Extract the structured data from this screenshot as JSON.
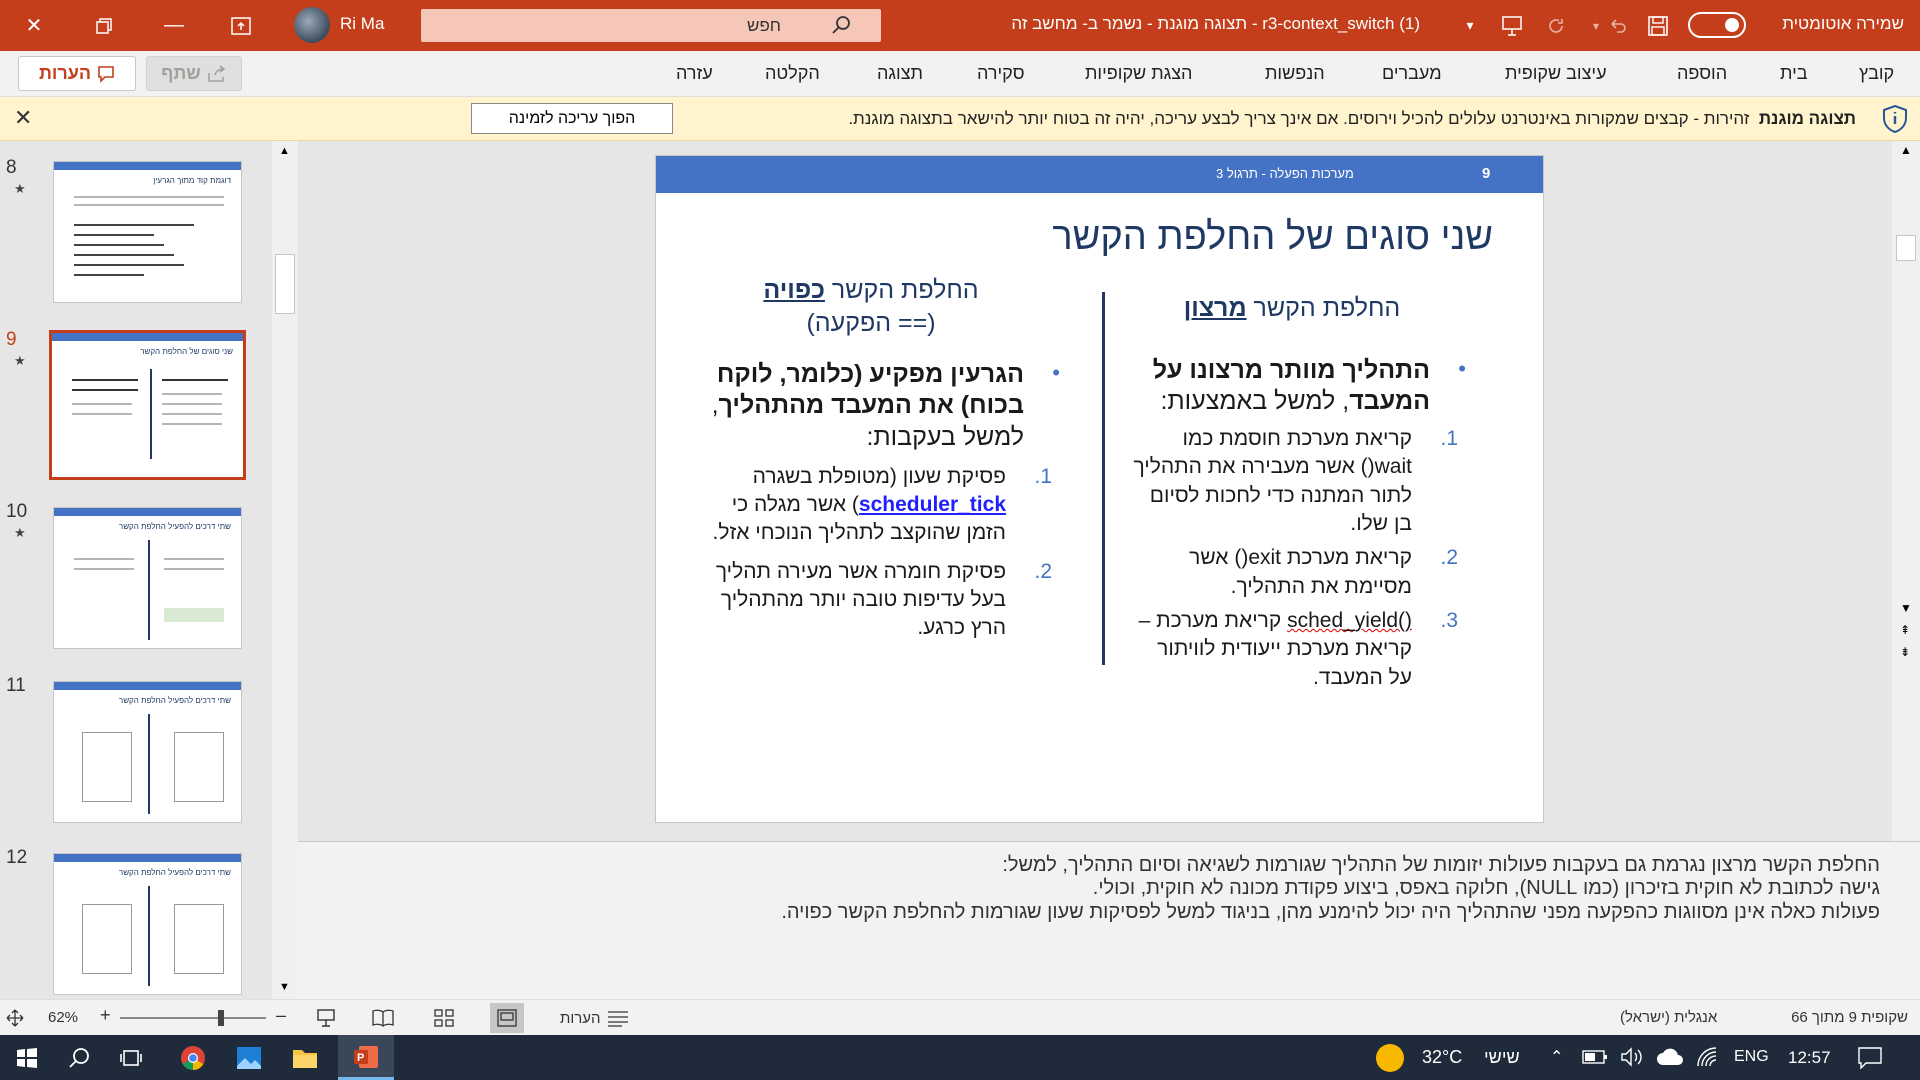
{
  "window": {
    "doc_title": "r3-context_switch (1)  -  תצוגה מוגנת  -  נשמר ב- מחשב זה",
    "autosave_label": "שמירה אוטומטית",
    "user_name": "Ri Ma",
    "search_placeholder": "חפש"
  },
  "menu": {
    "items": [
      "קובץ",
      "בית",
      "הוספה",
      "עיצוב שקופית",
      "מעברים",
      "הנפשות",
      "הצגת שקופיות",
      "סקירה",
      "תצוגה",
      "הקלטה",
      "עזרה"
    ],
    "comments_label": "הערות",
    "share_label": "שתף"
  },
  "protected_bar": {
    "title": "תצוגה מוגנת",
    "message": "זהירות - קבצים שמקורות באינטרנט עלולים להכיל וירוסים. אם אינך צריך לבצע עריכה, יהיה זה בטוח יותר להישאר בתצוגה מוגנת.",
    "enable_button": "הפוך עריכה לזמינה"
  },
  "thumbnails": [
    {
      "num": "8",
      "title": "דוגמת קוד מתוך הגרעין"
    },
    {
      "num": "9",
      "title": "שני סוגים של החלפת הקשר"
    },
    {
      "num": "10",
      "title": "שתי דרכים להפעיל החלפת הקשר"
    },
    {
      "num": "11",
      "title": "שתי דרכים להפעיל החלפת הקשר"
    },
    {
      "num": "12",
      "title": "שתי דרכים להפעיל החלפת הקשר"
    }
  ],
  "slide": {
    "number": "9",
    "header_text": "מערכות הפעלה - תרגול 3",
    "title": "שני סוגים של החלפת הקשר",
    "right_col": {
      "head_prefix": "החלפת הקשר ",
      "head_em": "מרצון",
      "bullet_bold": "התהליך מוותר מרצונו על המעבד",
      "bullet_rest": ", למשל באמצעות:",
      "items": [
        {
          "n": "1.",
          "text": "קריאת מערכת חוסמת כמו wait() אשר מעבירה את התהליך לתור המתנה כדי לחכות לסיום בן שלו."
        },
        {
          "n": "2.",
          "text": "קריאת מערכת exit() אשר מסיימת את התהליך."
        },
        {
          "n": "3.",
          "text_a": "sched_yield()",
          "text_b": " קריאת מערכת – קריאת מערכת ייעודית לוויתור על המעבד."
        }
      ]
    },
    "left_col": {
      "head_prefix": "החלפת הקשר ",
      "head_em": "כפויה",
      "head_sub": "(== הפקעה)",
      "bullet_bold": "הגרעין מפקיע (כלומר, לוקח בכוח) את המעבד מהתהליך",
      "bullet_rest": ", למשל בעקבות:",
      "items": [
        {
          "n": "1.",
          "text_a": "פסיקת שעון (מטופלת בשגרה ",
          "link": "scheduler_tick",
          "text_b": ") אשר מגלה כי הזמן שהוקצב לתהליך הנוכחי אזל."
        },
        {
          "n": "2.",
          "text": "פסיקת חומרה אשר מעירה תהליך בעל עדיפות טובה יותר מהתהליך הרץ כרגע."
        }
      ]
    }
  },
  "notes": [
    "החלפת הקשר מרצון נגרמת גם בעקבות פעולות יזומות של התהליך שגורמות לשגיאה וסיום התהליך, למשל:",
    "גישה לכתובת לא חוקית בזיכרון (כמו NULL), חלוקה באפס, ביצוע פקודת מכונה לא חוקית, וכולי.",
    "פעולות כאלה אינן מסווגות כהפקעה מפני שהתהליך היה יכול להימנע מהן, בניגוד למשל לפסיקות שעון שגורמות להחלפת הקשר כפויה."
  ],
  "status": {
    "slide_info": "שקופית 9 מתוך 66",
    "language": "אנגלית (ישראל)",
    "notes_label": "הערות",
    "zoom": "62%"
  },
  "taskbar": {
    "time": "12:57",
    "lang": "ENG",
    "day": "שישי",
    "temp": "32°C"
  },
  "colors": {
    "accent": "#c43e1c",
    "slide_header": "#4472c4",
    "slide_title": "#1f3864"
  }
}
